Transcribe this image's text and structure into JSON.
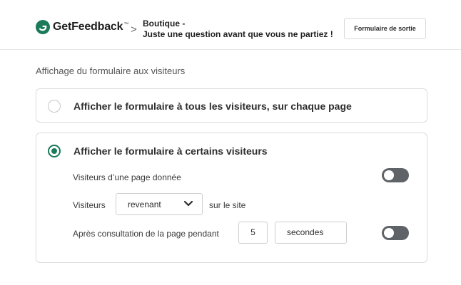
{
  "header": {
    "logo_text": "GetFeedback",
    "logo_tm": "™",
    "breadcrumb_line1": "Boutique -",
    "breadcrumb_line2": "Juste une question avant que vous ne partiez !",
    "exit_button_label": "Formulaire de sortie"
  },
  "main": {
    "section_title": "Affichage du formulaire aux visiteurs",
    "option_all_label": "Afficher le formulaire à tous les visiteurs, sur chaque page",
    "option_some_label": "Afficher le formulaire à certains visiteurs",
    "row_page_label": "Visiteurs d’une page donnée",
    "row_visitors_label": "Visiteurs",
    "visitor_type_value": "revenant",
    "row_visitors_suffix": "sur le site",
    "row_duration_label": "Après consultation de la page pendant",
    "duration_value": "5",
    "duration_unit": "secondes"
  },
  "state": {
    "selected_option": "some",
    "toggle_page_on": false,
    "toggle_duration_on": false
  },
  "colors": {
    "brand_green": "#1a7a5a",
    "toggle_off": "#5f6368"
  }
}
